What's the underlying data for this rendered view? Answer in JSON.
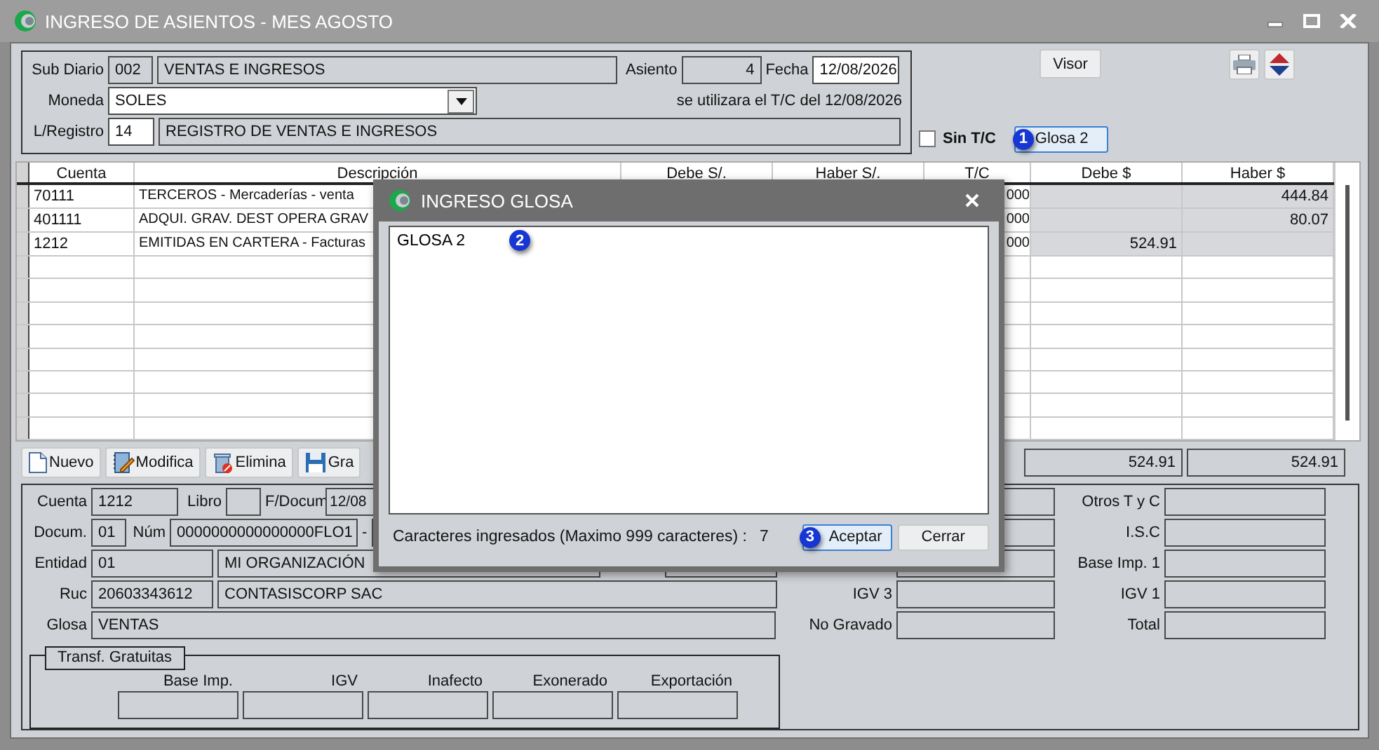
{
  "window": {
    "title": "INGRESO DE ASIENTOS - MES AGOSTO"
  },
  "header": {
    "sub_diario": {
      "label": "Sub Diario",
      "code": "002",
      "name": "VENTAS E INGRESOS"
    },
    "asiento": {
      "label": "Asiento",
      "value": "4"
    },
    "fecha": {
      "label": "Fecha",
      "value": "12/08/2026"
    },
    "moneda": {
      "label": "Moneda",
      "value": "SOLES"
    },
    "tc_note": "se utilizara el T/C del 12/08/2026",
    "registro": {
      "label": "L/Registro",
      "code": "14",
      "name": "REGISTRO DE VENTAS E INGRESOS"
    }
  },
  "visor_button": "Visor",
  "sin_tc": {
    "label": "Sin T/C",
    "checked": false
  },
  "glosa_button": {
    "label": "Glosa 2",
    "focused": true,
    "marker": "1"
  },
  "table": {
    "columns": [
      "Cuenta",
      "Descripción",
      "Debe S/.",
      "Haber S/.",
      "T/C",
      "Debe $",
      "Haber $"
    ],
    "rows": [
      {
        "cuenta": "70111",
        "descripcion": "TERCEROS - Mercaderías - venta",
        "tc": "000",
        "haber_usd": "444.84"
      },
      {
        "cuenta": "401111",
        "descripcion": "ADQUI. GRAV. DEST OPERA GRAV",
        "tc": "000",
        "haber_usd": "80.07"
      },
      {
        "cuenta": "1212",
        "descripcion": "EMITIDAS EN CARTERA - Facturas",
        "tc": "000",
        "debe_usd": "524.91"
      }
    ]
  },
  "toolbar": [
    {
      "label": "Nuevo",
      "kind": "new"
    },
    {
      "label": "Modifica",
      "kind": "edit"
    },
    {
      "label": "Elimina",
      "kind": "delete"
    },
    {
      "label": "Gra",
      "kind": "save"
    }
  ],
  "totals": [
    "524.91",
    "524.91"
  ],
  "detail": {
    "cuenta": {
      "label": "Cuenta",
      "value": "1212"
    },
    "libro": {
      "label": "Libro"
    },
    "f_docum": {
      "label": "F/Docum",
      "value": "12/08"
    },
    "docum": {
      "label": "Docum.",
      "value": "01"
    },
    "num": {
      "label": "Núm",
      "value": "0000000000000000FLO1",
      "separator": "-"
    },
    "entidad": {
      "label": "Entidad",
      "code": "01",
      "name": "MI ORGANIZACIÓN"
    },
    "ruc": {
      "label": "Ruc",
      "value": "20603343612",
      "name": "CONTASISCORP SAC"
    },
    "glosa": {
      "label": "Glosa",
      "value": "VENTAS"
    },
    "middle": [
      {
        "label": "IGV 3"
      },
      {
        "label": "No Gravado"
      }
    ],
    "right": [
      {
        "label": "Otros T y C"
      },
      {
        "label": "I.S.C"
      },
      {
        "label": "Base Imp. 1"
      },
      {
        "label": "IGV 1"
      },
      {
        "label": "Total"
      }
    ],
    "transf": {
      "title": "Transf. Gratuitas",
      "columns": [
        "Base Imp.",
        "IGV",
        "Inafecto",
        "Exonerado",
        "Exportación"
      ]
    }
  },
  "dialog": {
    "title": "INGRESO GLOSA",
    "text": "GLOSA 2",
    "marker": "2",
    "count_label": "Caracteres ingresados (Maximo 999 caracteres) :",
    "count": "7",
    "buttons": [
      {
        "label": "Aceptar",
        "focused": true,
        "marker": "3"
      },
      {
        "label": "Cerrar",
        "focused": false
      }
    ]
  }
}
